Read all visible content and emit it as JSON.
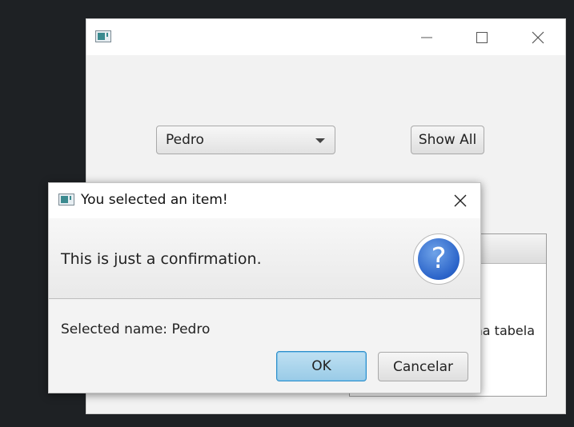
{
  "main_window": {
    "title": "",
    "combo_value": "Pedro",
    "show_all_label": "Show All",
    "table_placeholder": "Nenhum conteúdo na tabela"
  },
  "dialog": {
    "title": "You selected an item!",
    "header_text": "This is just a confirmation.",
    "content_text": "Selected name: Pedro",
    "ok_label": "OK",
    "cancel_label": "Cancelar",
    "icon": "question-icon"
  },
  "colors": {
    "ok_button_fill": "#9fcde8",
    "ok_button_border": "#2f8fc9",
    "question_icon": "#2a63c9",
    "desktop_background": "#1e2124"
  }
}
